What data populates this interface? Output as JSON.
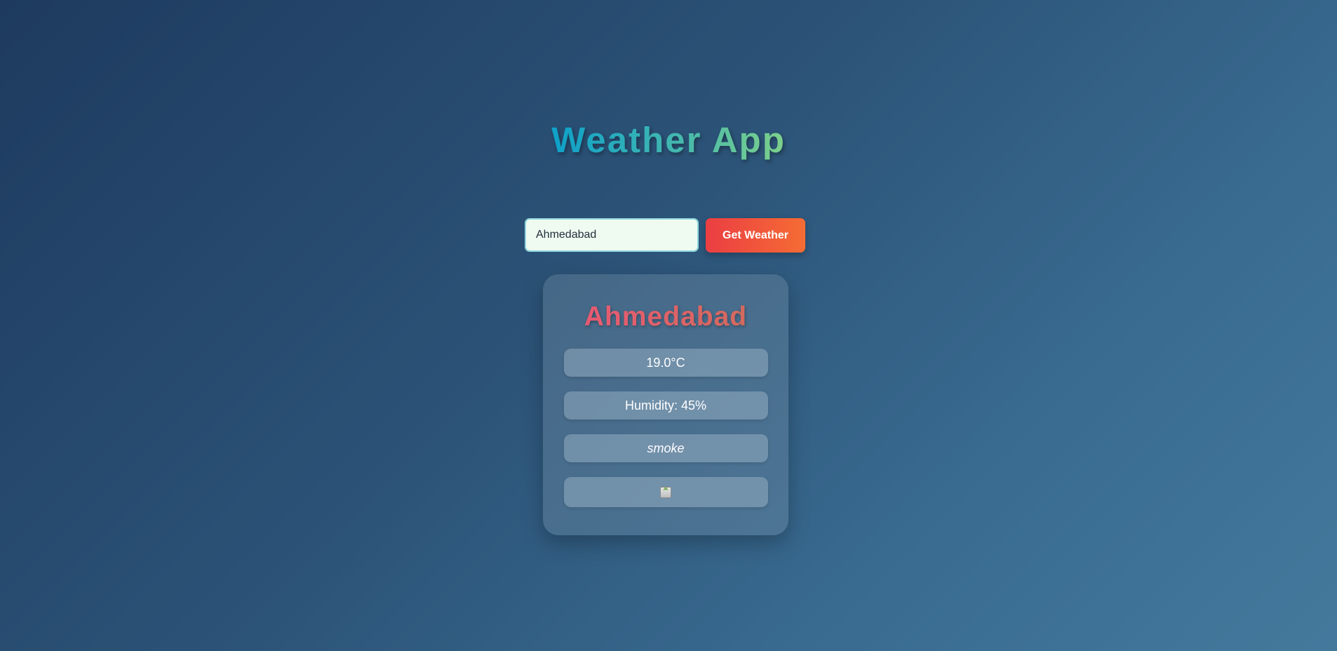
{
  "app": {
    "title": "Weather App"
  },
  "search": {
    "value": "Ahmedabad",
    "button_label": "Get Weather"
  },
  "weather": {
    "city": "Ahmedabad",
    "temperature": "19.0°C",
    "humidity": "Humidity: 45%",
    "description": "smoke",
    "icon": "broken-image-icon"
  },
  "colors": {
    "title_gradient": [
      "#0ea0c9",
      "#7ed18a"
    ],
    "button_gradient": [
      "#eb3e43",
      "#f56c34"
    ],
    "city_gradient": [
      "#e85a72",
      "#d46a5e"
    ]
  }
}
